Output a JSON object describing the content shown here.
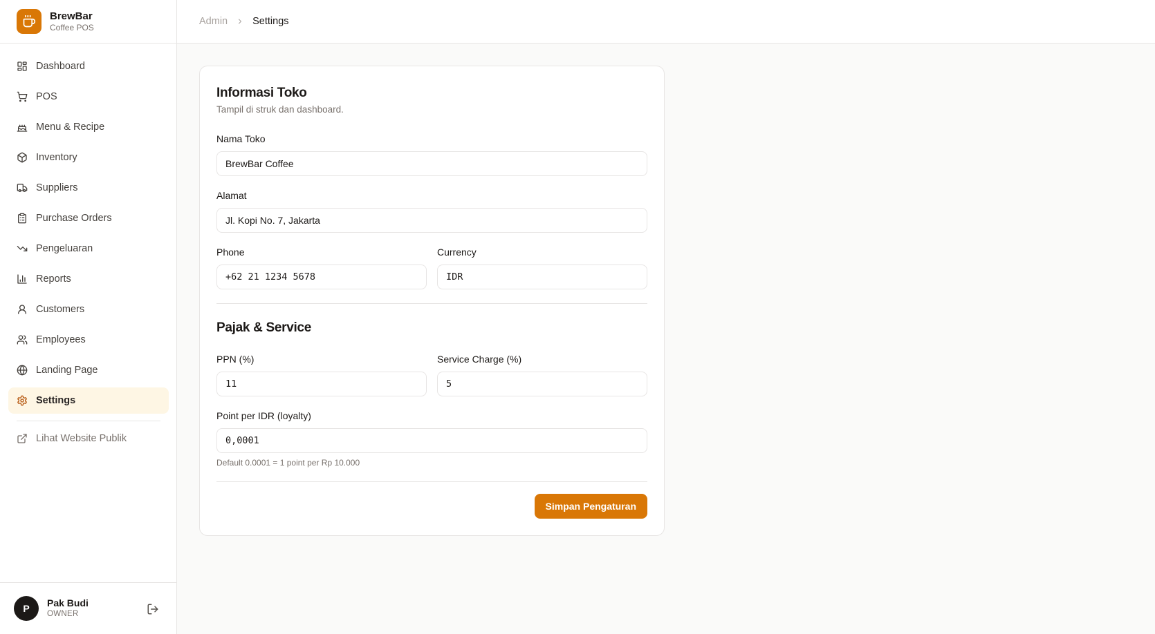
{
  "brand": {
    "name": "BrewBar",
    "subtitle": "Coffee POS",
    "accent": "#d97706"
  },
  "nav": {
    "items": [
      {
        "label": "Dashboard",
        "icon": "dashboard-icon"
      },
      {
        "label": "POS",
        "icon": "cart-icon"
      },
      {
        "label": "Menu & Recipe",
        "icon": "cake-icon"
      },
      {
        "label": "Inventory",
        "icon": "package-icon"
      },
      {
        "label": "Suppliers",
        "icon": "truck-icon"
      },
      {
        "label": "Purchase Orders",
        "icon": "clipboard-icon"
      },
      {
        "label": "Pengeluaran",
        "icon": "trending-down-icon"
      },
      {
        "label": "Reports",
        "icon": "bar-chart-icon"
      },
      {
        "label": "Customers",
        "icon": "user-icon"
      },
      {
        "label": "Employees",
        "icon": "users-icon"
      },
      {
        "label": "Landing Page",
        "icon": "globe-icon"
      },
      {
        "label": "Settings",
        "icon": "gear-icon",
        "active": true
      }
    ],
    "external": {
      "label": "Lihat Website Publik",
      "icon": "external-link-icon"
    }
  },
  "user": {
    "initial": "P",
    "name": "Pak Budi",
    "role": "OWNER"
  },
  "breadcrumb": {
    "parent": "Admin",
    "current": "Settings"
  },
  "store": {
    "title": "Informasi Toko",
    "description": "Tampil di struk dan dashboard.",
    "name_label": "Nama Toko",
    "name_value": "BrewBar Coffee",
    "address_label": "Alamat",
    "address_value": "Jl. Kopi No. 7, Jakarta",
    "phone_label": "Phone",
    "phone_value": "+62 21 1234 5678",
    "currency_label": "Currency",
    "currency_value": "IDR"
  },
  "tax": {
    "title": "Pajak & Service",
    "ppn_label": "PPN (%)",
    "ppn_value": "11",
    "service_label": "Service Charge (%)",
    "service_value": "5",
    "point_label": "Point per IDR (loyalty)",
    "point_value": "0,0001",
    "point_hint": "Default 0.0001 = 1 point per Rp 10.000"
  },
  "actions": {
    "save_label": "Simpan Pengaturan"
  }
}
